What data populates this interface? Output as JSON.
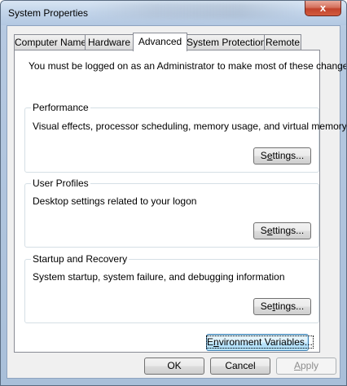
{
  "window": {
    "title": "System Properties",
    "close_glyph": "x"
  },
  "tabs": [
    {
      "label": "Computer Name",
      "active": false
    },
    {
      "label": "Hardware",
      "active": false
    },
    {
      "label": "Advanced",
      "active": true
    },
    {
      "label": "System Protection",
      "active": false
    },
    {
      "label": "Remote",
      "active": false
    }
  ],
  "advanced": {
    "notice": "You must be logged on as an Administrator to make most of these changes.",
    "performance": {
      "label": "Performance",
      "description": "Visual effects, processor scheduling, memory usage, and virtual memory",
      "button_prefix": "S",
      "button_mnemonic": "e",
      "button_suffix": "ttings..."
    },
    "user_profiles": {
      "label": "User Profiles",
      "description": "Desktop settings related to your logon",
      "button_prefix": "S",
      "button_mnemonic": "e",
      "button_suffix": "ttings..."
    },
    "startup_recovery": {
      "label": "Startup and Recovery",
      "description": "System startup, system failure, and debugging information",
      "button_prefix": "Se",
      "button_mnemonic": "t",
      "button_suffix": "tings..."
    },
    "env_button": {
      "prefix": "E",
      "mnemonic": "n",
      "suffix": "vironment Variables..."
    }
  },
  "footer": {
    "ok_label": "OK",
    "cancel_label": "Cancel",
    "apply_mnemonic": "A",
    "apply_suffix": "pply",
    "apply_disabled": true
  }
}
